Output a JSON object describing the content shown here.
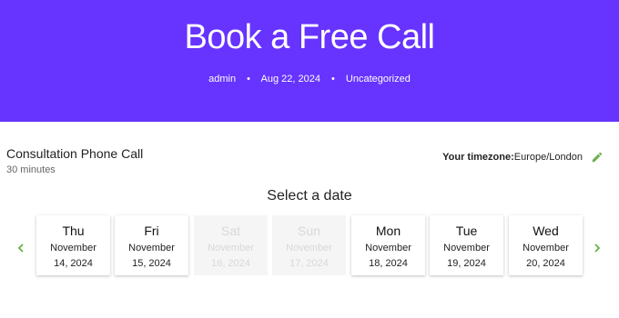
{
  "hero": {
    "title": "Book a Free Call",
    "author": "admin",
    "date": "Aug 22, 2024",
    "category": "Uncategorized",
    "separator": "•",
    "background": "#6633ff"
  },
  "event": {
    "title": "Consultation Phone Call",
    "duration": "30 minutes"
  },
  "timezone": {
    "label": "Your timezone:",
    "value": "Europe/London",
    "edit_icon": "pencil-icon",
    "icon_color": "#6ab04c"
  },
  "picker": {
    "heading": "Select a date",
    "prev_icon": "chevron-left-icon",
    "next_icon": "chevron-right-icon",
    "arrow_color": "#6ab04c",
    "days": [
      {
        "dow": "Thu",
        "month": "November",
        "dayyear": "14, 2024",
        "available": true
      },
      {
        "dow": "Fri",
        "month": "November",
        "dayyear": "15, 2024",
        "available": true
      },
      {
        "dow": "Sat",
        "month": "November",
        "dayyear": "16, 2024",
        "available": false
      },
      {
        "dow": "Sun",
        "month": "November",
        "dayyear": "17, 2024",
        "available": false
      },
      {
        "dow": "Mon",
        "month": "November",
        "dayyear": "18, 2024",
        "available": true
      },
      {
        "dow": "Tue",
        "month": "November",
        "dayyear": "19, 2024",
        "available": true
      },
      {
        "dow": "Wed",
        "month": "November",
        "dayyear": "20, 2024",
        "available": true
      }
    ]
  }
}
